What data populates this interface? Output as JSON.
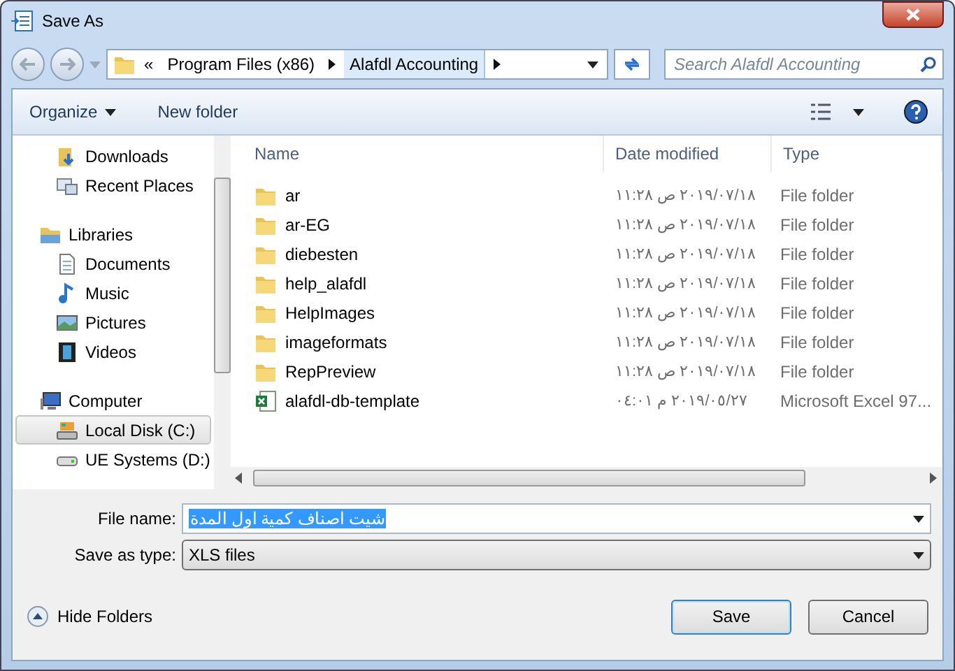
{
  "window": {
    "title": "Save As"
  },
  "address": {
    "overflow": "«",
    "crumbs": [
      {
        "label": "Program Files (x86)",
        "selected": false
      },
      {
        "label": "Alafdl Accounting",
        "selected": true
      }
    ]
  },
  "search": {
    "placeholder": "Search Alafdl Accounting"
  },
  "toolbar": {
    "organize": "Organize",
    "new_folder": "New folder"
  },
  "sidebar": {
    "items": [
      {
        "label": "Downloads",
        "selected": false
      },
      {
        "label": "Recent Places",
        "selected": false
      },
      {
        "label": "Libraries",
        "selected": false,
        "children": [
          {
            "label": "Documents",
            "selected": false
          },
          {
            "label": "Music",
            "selected": false
          },
          {
            "label": "Pictures",
            "selected": false
          },
          {
            "label": "Videos",
            "selected": false
          }
        ]
      },
      {
        "label": "Computer",
        "selected": false,
        "children": [
          {
            "label": "Local Disk (C:)",
            "selected": true
          },
          {
            "label": "UE Systems (D:)",
            "selected": false
          }
        ]
      }
    ]
  },
  "table": {
    "columns": [
      "Name",
      "Date modified",
      "Type"
    ],
    "rows": [
      {
        "kind": "folder",
        "name": "ar",
        "date": "٢٠١٩/٠٧/١٨ ص ١١:٢٨",
        "type": "File folder"
      },
      {
        "kind": "folder",
        "name": "ar-EG",
        "date": "٢٠١٩/٠٧/١٨ ص ١١:٢٨",
        "type": "File folder"
      },
      {
        "kind": "folder",
        "name": "diebesten",
        "date": "٢٠١٩/٠٧/١٨ ص ١١:٢٨",
        "type": "File folder"
      },
      {
        "kind": "folder",
        "name": "help_alafdl",
        "date": "٢٠١٩/٠٧/١٨ ص ١١:٢٨",
        "type": "File folder"
      },
      {
        "kind": "folder",
        "name": "HelpImages",
        "date": "٢٠١٩/٠٧/١٨ ص ١١:٢٨",
        "type": "File folder"
      },
      {
        "kind": "folder",
        "name": "imageformats",
        "date": "٢٠١٩/٠٧/١٨ ص ١١:٢٨",
        "type": "File folder"
      },
      {
        "kind": "folder",
        "name": "RepPreview",
        "date": "٢٠١٩/٠٧/١٨ ص ١١:٢٨",
        "type": "File folder"
      },
      {
        "kind": "spreadsheet",
        "name": "alafdl-db-template",
        "date": "٢٠١٩/٠٥/٢٧ م ٠٤:٠١",
        "type": "Microsoft Excel 97..."
      }
    ]
  },
  "form": {
    "file_name_label": "File name:",
    "file_name": "شيت اصناف كمية اول المدة",
    "type_label": "Save as type:",
    "type_value": "XLS files"
  },
  "hide_folders": "Hide Folders",
  "buttons": [
    {
      "label": "Save",
      "kind": "primary"
    },
    {
      "label": "Cancel",
      "kind": "normal"
    }
  ]
}
